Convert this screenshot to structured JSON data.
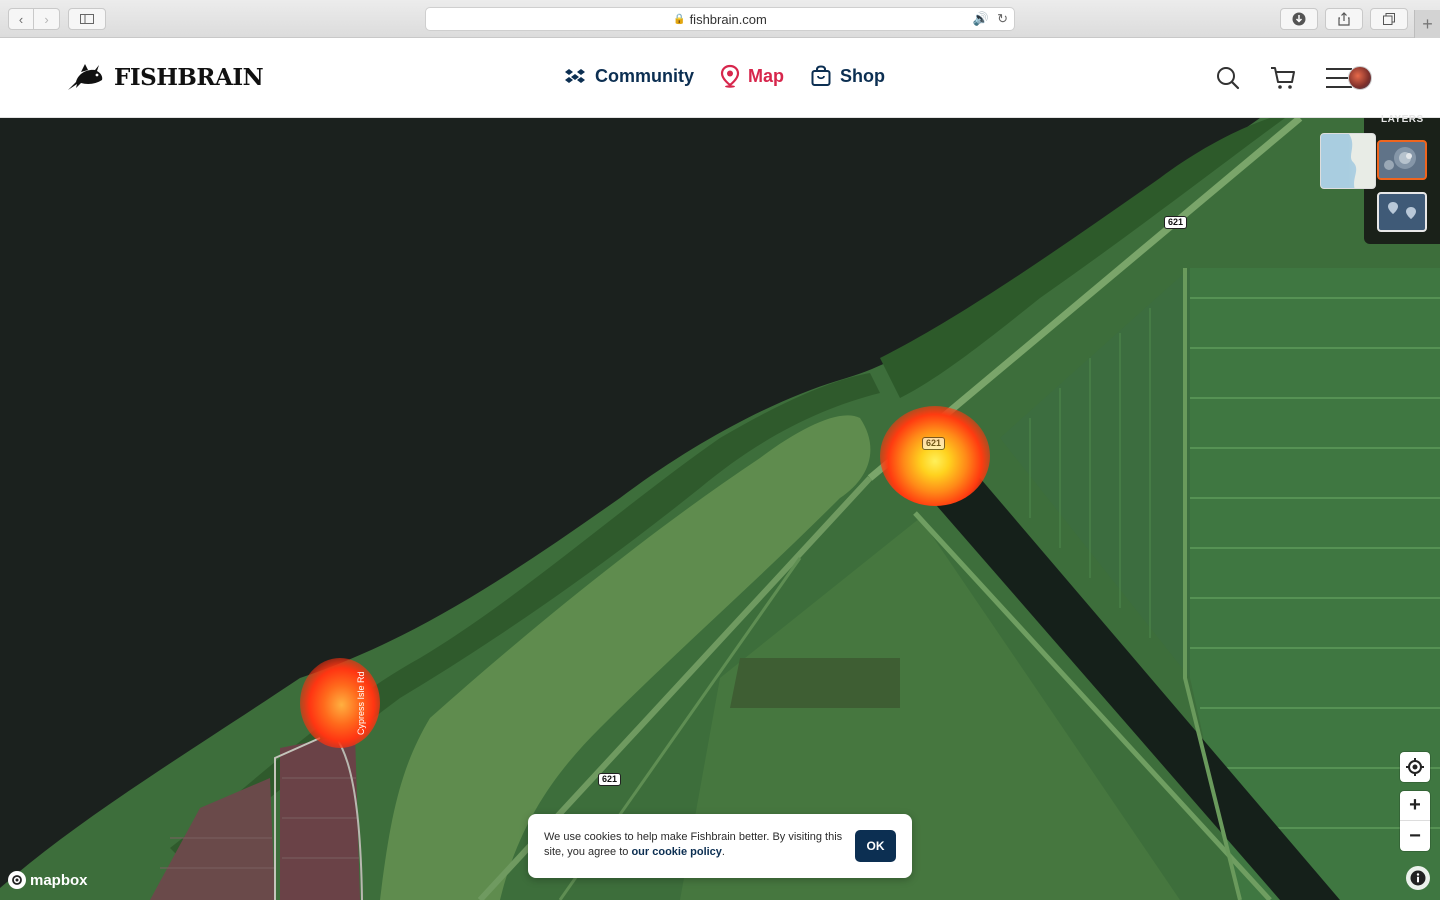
{
  "browser": {
    "url": "fishbrain.com"
  },
  "header": {
    "logo_text": "FISHBRAIN",
    "nav": [
      {
        "label": "Community",
        "icon": "community-icon"
      },
      {
        "label": "Map",
        "icon": "map-pin-icon"
      },
      {
        "label": "Shop",
        "icon": "shopping-bag-icon"
      }
    ],
    "active_color": "#d7264c",
    "nav_color": "#0c2f52"
  },
  "map": {
    "road_shields": [
      "621",
      "621",
      "621"
    ],
    "road_name": "Cypress Isle Rd",
    "attribution": "mapbox"
  },
  "layers": {
    "title": "LAYERS"
  },
  "controls": {
    "zoom_in": "+",
    "zoom_out": "−"
  },
  "cookie": {
    "text_before": "We use cookies to help make Fishbrain better. By visiting this site, you agree to ",
    "link": "our cookie policy",
    "text_after": ".",
    "ok": "OK"
  }
}
